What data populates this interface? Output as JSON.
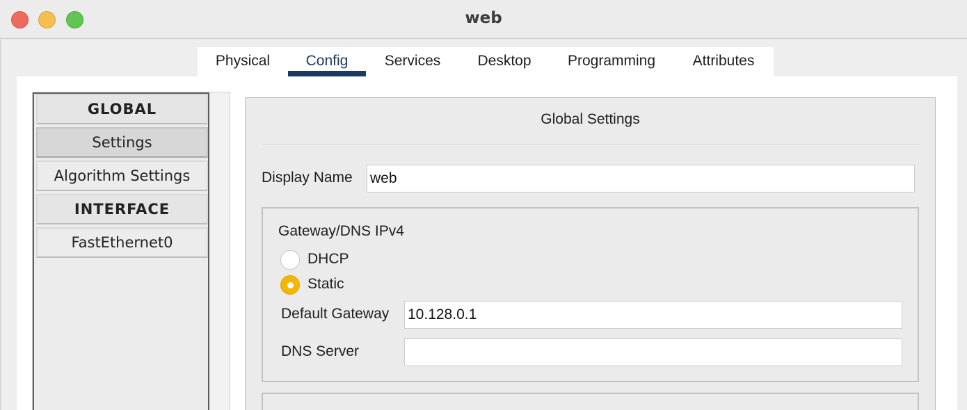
{
  "window": {
    "title": "web",
    "controls": {
      "close": "close-icon",
      "minimize": "minimize-icon",
      "maximize": "maximize-icon"
    },
    "colors": {
      "close": "#ed6a5e",
      "minimize": "#f5bf4f",
      "maximize": "#61c554"
    }
  },
  "tabs": [
    {
      "label": "Physical",
      "active": false
    },
    {
      "label": "Config",
      "active": true
    },
    {
      "label": "Services",
      "active": false
    },
    {
      "label": "Desktop",
      "active": false
    },
    {
      "label": "Programming",
      "active": false
    },
    {
      "label": "Attributes",
      "active": false
    }
  ],
  "sidebar": {
    "items": [
      {
        "label": "GLOBAL",
        "kind": "header"
      },
      {
        "label": "Settings",
        "kind": "item",
        "selected": true
      },
      {
        "label": "Algorithm Settings",
        "kind": "item"
      },
      {
        "label": "INTERFACE",
        "kind": "header"
      },
      {
        "label": "FastEthernet0",
        "kind": "item"
      }
    ]
  },
  "main": {
    "title": "Global Settings",
    "display_name_label": "Display Name",
    "display_name_value": "web",
    "ipv4_group": {
      "title": "Gateway/DNS IPv4",
      "dhcp_label": "DHCP",
      "static_label": "Static",
      "selected": "Static",
      "gateway_label": "Default Gateway",
      "gateway_value": "10.128.0.1",
      "dns_label": "DNS Server",
      "dns_value": ""
    },
    "accent_color": "#f2b705",
    "tab_accent_color": "#1b3a63"
  }
}
